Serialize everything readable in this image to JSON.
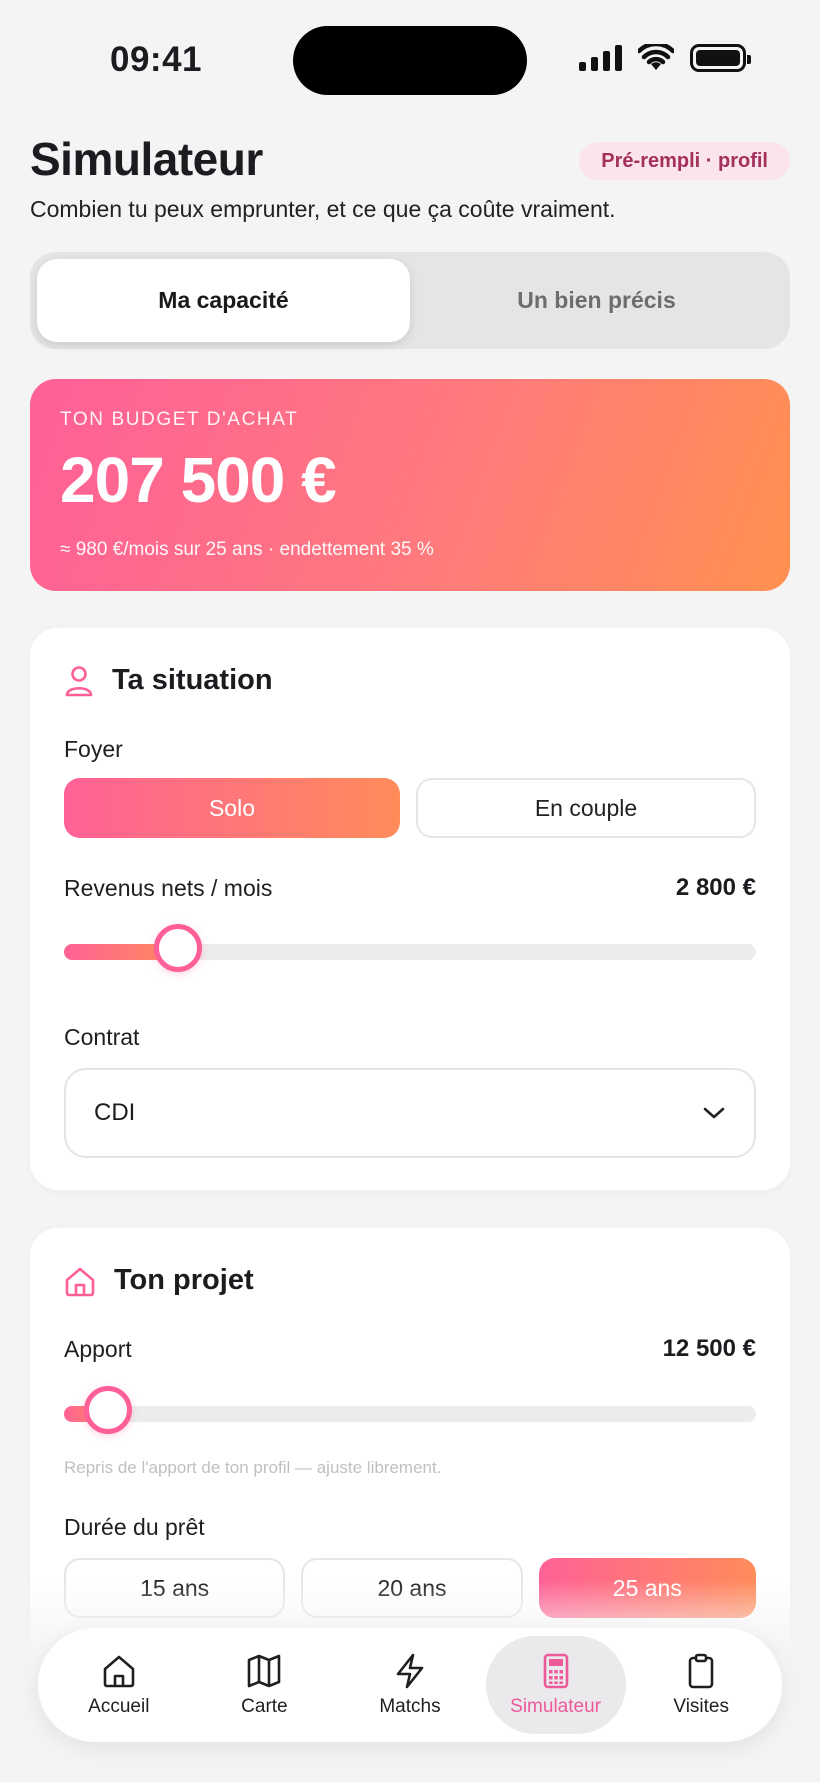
{
  "status_bar": {
    "time": "09:41"
  },
  "header": {
    "title": "Simulateur",
    "badge": "Pré-rempli · profil",
    "subtitle": "Combien tu peux emprunter, et ce que ça coûte vraiment."
  },
  "segmented": {
    "tabs": [
      "Ma capacité",
      "Un bien précis"
    ],
    "active_index": 0
  },
  "budget": {
    "label": "TON BUDGET D'ACHAT",
    "amount": "207 500 €",
    "details": "≈ 980 €/mois sur 25 ans · endettement 35 %"
  },
  "situation": {
    "title": "Ta situation",
    "icon": "user-icon",
    "household_label": "Foyer",
    "household_options": [
      "Solo",
      "En couple"
    ],
    "household_selected": "Solo",
    "income_label": "Revenus nets / mois",
    "income_value": "2 800 €",
    "income_slider_fraction": 0.165,
    "contract_label": "Contrat",
    "contract_value": "CDI"
  },
  "projet": {
    "title": "Ton projet",
    "icon": "home-icon",
    "apport_label": "Apport",
    "apport_value": "12 500 €",
    "apport_slider_fraction": 0.063,
    "apport_hint": "Repris de l'apport de ton profil — ajuste librement.",
    "duration_label": "Durée du prêt",
    "duration_options": [
      "15 ans",
      "20 ans",
      "25 ans"
    ],
    "duration_selected": "25 ans"
  },
  "tab_bar": {
    "items": [
      {
        "label": "Accueil",
        "icon": "home-icon"
      },
      {
        "label": "Carte",
        "icon": "map-icon"
      },
      {
        "label": "Matchs",
        "icon": "lightning-icon"
      },
      {
        "label": "Simulateur",
        "icon": "calculator-icon"
      },
      {
        "label": "Visites",
        "icon": "clipboard-icon"
      }
    ],
    "active_index": 3
  },
  "colors": {
    "accent_pink": "#ff5f98",
    "accent_orange": "#ff9150",
    "active_tab": "#ec5a9a",
    "badge_bg": "#fbe4ec",
    "badge_text": "#a3315c"
  }
}
